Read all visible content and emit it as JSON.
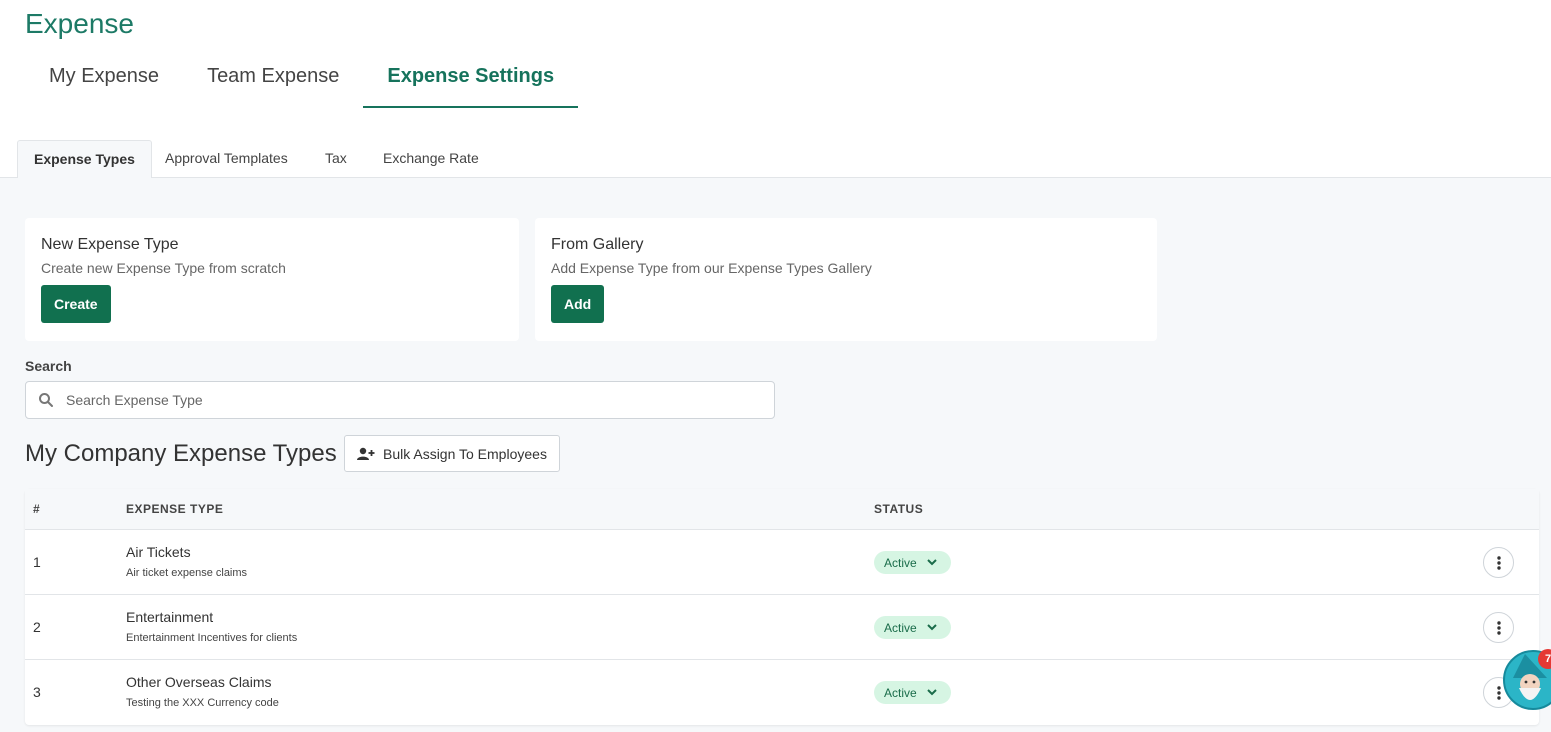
{
  "page_title": "Expense",
  "main_tabs": [
    {
      "label": "My Expense"
    },
    {
      "label": "Team Expense"
    },
    {
      "label": "Expense Settings"
    }
  ],
  "sub_tabs": [
    {
      "label": "Expense Types"
    },
    {
      "label": "Approval Templates"
    },
    {
      "label": "Tax"
    },
    {
      "label": "Exchange Rate"
    }
  ],
  "cards": {
    "new": {
      "title": "New Expense Type",
      "desc": "Create new Expense Type from scratch",
      "button": "Create"
    },
    "gallery": {
      "title": "From Gallery",
      "desc": "Add Expense Type from our Expense Types Gallery",
      "button": "Add"
    }
  },
  "search": {
    "label": "Search",
    "placeholder": "Search Expense Type",
    "value": ""
  },
  "section": {
    "title": "My Company Expense Types",
    "bulk_button": "Bulk Assign To Employees"
  },
  "table": {
    "headers": {
      "num": "#",
      "type": "EXPENSE TYPE",
      "status": "STATUS"
    },
    "rows": [
      {
        "num": "1",
        "name": "Air Tickets",
        "desc": "Air ticket expense claims",
        "status": "Active"
      },
      {
        "num": "2",
        "name": "Entertainment",
        "desc": "Entertainment Incentives for clients",
        "status": "Active"
      },
      {
        "num": "3",
        "name": "Other Overseas Claims",
        "desc": "Testing the XXX Currency code",
        "status": "Active"
      }
    ]
  },
  "assistant": {
    "badge": "7"
  },
  "colors": {
    "accent": "#16735c",
    "button": "#11704f",
    "status_bg": "#d6f5e3",
    "status_text": "#1a6c4a"
  }
}
